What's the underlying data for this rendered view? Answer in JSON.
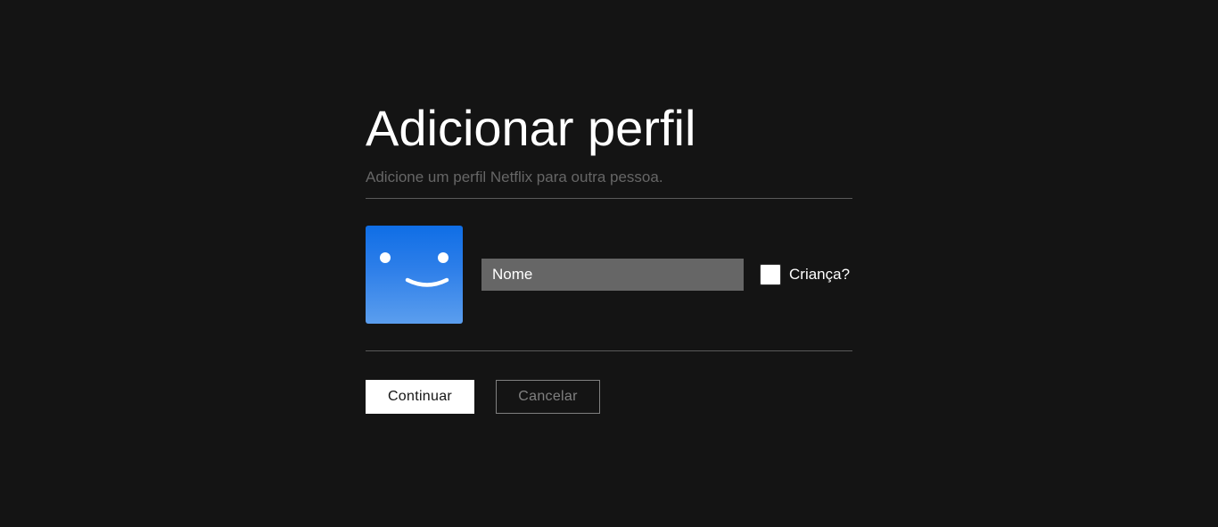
{
  "page": {
    "title": "Adicionar perfil",
    "subtitle": "Adicione um perfil Netflix para outra pessoa."
  },
  "profile": {
    "avatar_icon": "smiley-face-icon",
    "name_placeholder": "Nome",
    "name_value": "",
    "kids_label": "Criança?",
    "kids_checked": false
  },
  "actions": {
    "continue_label": "Continuar",
    "cancel_label": "Cancelar"
  },
  "colors": {
    "background": "#141414",
    "avatar_blue": "#0f6ee6",
    "input_bg": "#666666",
    "subtitle": "#666666",
    "button_primary_bg": "#ffffff"
  }
}
